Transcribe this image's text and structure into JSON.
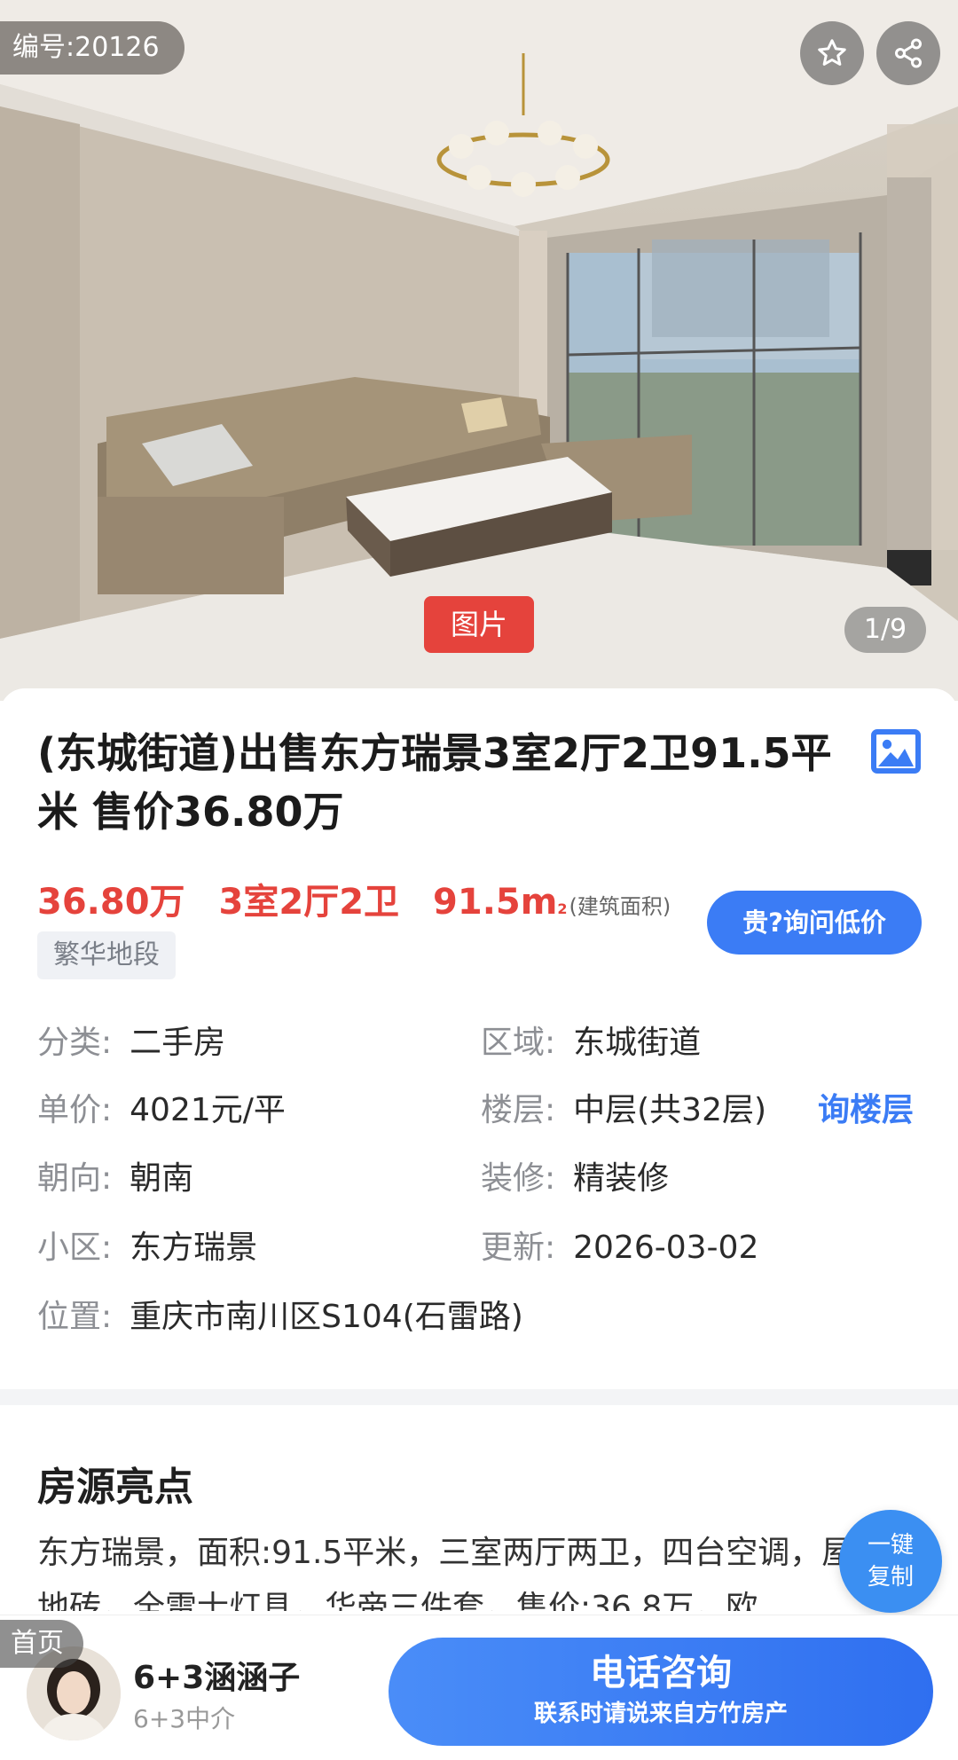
{
  "hero": {
    "listing_id": "编号:20126",
    "photo_tag": "图片",
    "photo_counter": "1/9",
    "icons": [
      "star-icon",
      "share-icon"
    ]
  },
  "listing": {
    "title": "(东城街道)出售东方瑞景3室2厅2卫91.5平米 售价36.80万",
    "title_icon": "image-icon",
    "price": "36.80万",
    "layout": "3室2厅2卫",
    "area": "91.5m",
    "area_sup": "2",
    "area_note": "(建筑面积)",
    "tag": "繁华地段",
    "ask_button": "贵?询问低价",
    "accent_color": "#e5433c",
    "brand_color": "#3b7cf5"
  },
  "attributes": {
    "category": {
      "label": "分类:",
      "value": "二手房"
    },
    "district": {
      "label": "区域:",
      "value": "东城街道"
    },
    "unit_price": {
      "label": "单价:",
      "value": "4021元/平"
    },
    "floor": {
      "label": "楼层:",
      "value": "中层(共32层)"
    },
    "floor_link": "询楼层",
    "orientation": {
      "label": "朝向:",
      "value": "朝南"
    },
    "decoration": {
      "label": "装修:",
      "value": "精装修"
    },
    "community": {
      "label": "小区:",
      "value": "东方瑞景"
    },
    "updated": {
      "label": "更新:",
      "value": "2026-03-02"
    },
    "location": {
      "label": "位置:",
      "value": "重庆市南川区S104(石雷路)"
    }
  },
  "highlights": {
    "title": "房源亮点",
    "text": "东方瑞景，面积:91.5平米，三室两厅两卫，四台空调，屋通铺地砖，全雷士灯具，华帝三件套，售价:36.8万，欧",
    "copy_button_line1": "一键",
    "copy_button_line2": "复制"
  },
  "bottom_bar": {
    "home_tag": "首页",
    "agent_name": "6+3涵涵子",
    "agent_company": "6+3中介",
    "call_main": "电话咨询",
    "call_sub": "联系时请说来自方竹房产"
  }
}
